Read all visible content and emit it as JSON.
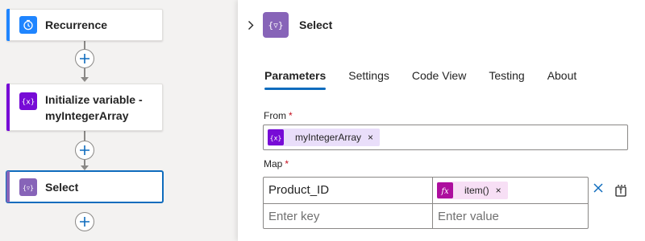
{
  "flow": {
    "steps": [
      {
        "title": "Recurrence",
        "icon": "clock-icon",
        "accent": "#1f85ff"
      },
      {
        "title": "Initialize variable - myIntegerArray",
        "icon": "variable-icon",
        "accent": "#770bd6"
      },
      {
        "title": "Select",
        "icon": "data-operation-icon",
        "accent": "#8764b8"
      }
    ]
  },
  "panel": {
    "title": "Select",
    "icon": "data-operation-icon",
    "tabs": [
      "Parameters",
      "Settings",
      "Code View",
      "Testing",
      "About"
    ],
    "active_tab": "Parameters",
    "from": {
      "label": "From",
      "required_mark": "*",
      "token": {
        "text": "myIntegerArray",
        "icon": "variable-icon",
        "remove": "×"
      }
    },
    "map": {
      "label": "Map",
      "required_mark": "*",
      "rows": [
        {
          "key": "Product_ID",
          "value_token": {
            "text": "item()",
            "icon": "fx-icon",
            "remove": "×"
          }
        },
        {
          "key_placeholder": "Enter key",
          "value_placeholder": "Enter value"
        }
      ]
    }
  },
  "colors": {
    "accent_blue": "#0f6cbd",
    "variable_purple": "#770bd6",
    "data_operation_purple": "#8764b8",
    "token_variable_bg": "#e9defa",
    "token_expression_bg": "#f7dff5",
    "expression_icon_bg": "#ad0e9e",
    "required_red": "#c50f1f"
  }
}
